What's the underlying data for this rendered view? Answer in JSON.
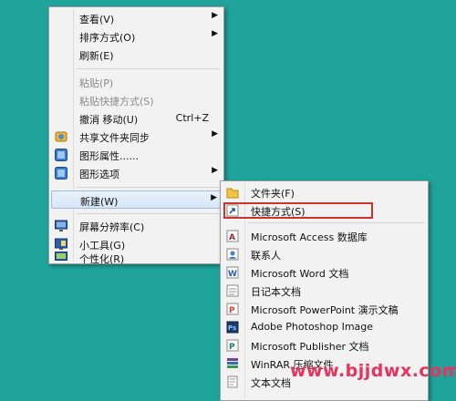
{
  "context_menu": {
    "view": "查看(V)",
    "sort": "排序方式(O)",
    "refresh": "刷新(E)",
    "paste": "粘贴(P)",
    "paste_shortcut": "粘贴快捷方式(S)",
    "undo_move": "撤消 移动(U)",
    "undo_shortcut": "Ctrl+Z",
    "share_sync": "共享文件夹同步",
    "graphics_props": "图形属性......",
    "graphics_options": "图形选项",
    "new": "新建(W)",
    "screen_resolution": "屏幕分辨率(C)",
    "gadgets": "小工具(G)",
    "personalize": "个性化(R)"
  },
  "submenu": {
    "folder": "文件夹(F)",
    "shortcut": "快捷方式(S)",
    "access": "Microsoft Access 数据库",
    "contact": "联系人",
    "word": "Microsoft Word 文档",
    "journal": "日记本文档",
    "powerpoint": "Microsoft PowerPoint 演示文稿",
    "photoshop": "Adobe Photoshop Image",
    "publisher": "Microsoft Publisher 文档",
    "winrar": "WinRAR 压缩文件",
    "text": "文本文档"
  },
  "watermark": "www.bjjdwx.com",
  "colors": {
    "desktop": "#1fa39a",
    "highlight_box": "#c8352a",
    "watermark": "#e8325f"
  }
}
